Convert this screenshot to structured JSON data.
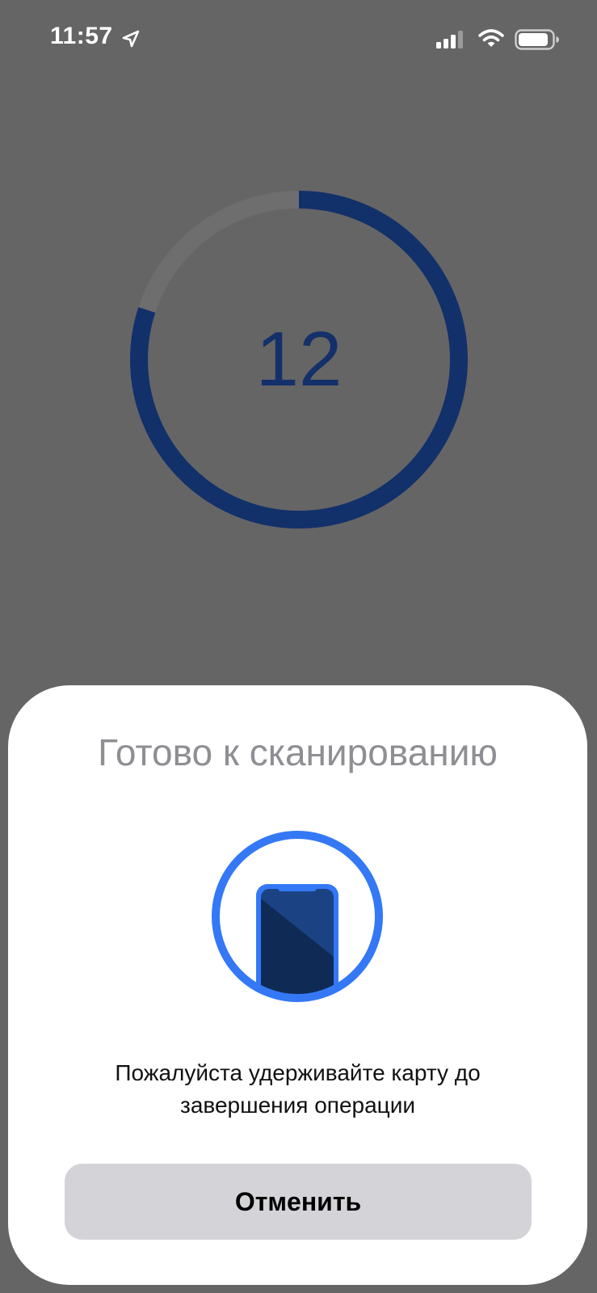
{
  "status_bar": {
    "time": "11:57",
    "icons": [
      "location-arrow-icon",
      "cellular-signal-icon",
      "wifi-icon",
      "battery-icon"
    ]
  },
  "countdown": {
    "value": "12",
    "progress_fraction": 0.8,
    "ring_color": "#12306a",
    "track_color": "#6e6e6e"
  },
  "sheet": {
    "title": "Готово к сканированию",
    "illustration": "phone-scan-icon",
    "message": "Пожалуйста удерживайте карту до завершения операции",
    "cancel_label": "Отменить",
    "accent_color": "#3478f6"
  }
}
